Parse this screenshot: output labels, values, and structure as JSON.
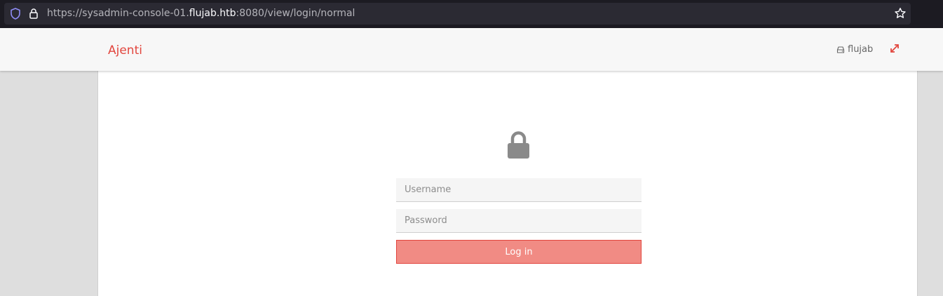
{
  "browser": {
    "url_prefix": "https://sysadmin-console-01.",
    "url_host": "flujab.htb",
    "url_suffix": ":8080/view/login/normal",
    "icons": [
      "shield-icon",
      "lock-icon",
      "star-icon"
    ]
  },
  "navbar": {
    "brand": "Ajenti",
    "hostname": "flujab",
    "hostname_icon": "hdd-icon",
    "expand_icon": "expand-icon"
  },
  "login": {
    "icon": "lock-icon",
    "username_placeholder": "Username",
    "password_placeholder": "Password",
    "login_label": "Log in"
  },
  "colors": {
    "accent": "#e2463e",
    "button_bg": "#f18b84",
    "navbar_bg": "#f7f7f7",
    "page_bg": "#dedede"
  }
}
